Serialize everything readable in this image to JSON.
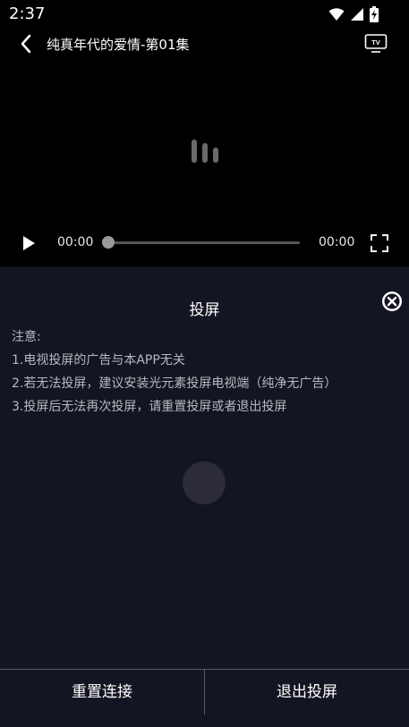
{
  "status_bar": {
    "time": "2:37",
    "icons": [
      "wifi-icon",
      "signal-icon",
      "battery-charging-icon"
    ]
  },
  "header": {
    "title": "纯真年代的爱情-第01集",
    "back_icon": "chevron-left-icon",
    "tv_icon": "tv-cast-icon",
    "tv_label": "TV"
  },
  "player": {
    "current_time": "00:00",
    "total_time": "00:00",
    "progress": 0,
    "play_icon": "play-icon",
    "fullscreen_icon": "fullscreen-icon",
    "loading_icon": "loading-bars-icon"
  },
  "cast_panel": {
    "title": "投屏",
    "close_icon": "close-icon",
    "notes": [
      "注意:",
      "1.电视投屏的广告与本APP无关",
      "2.若无法投屏，建议安装光元素投屏电视端（纯净无广告）",
      "3.投屏后无法再次投屏，请重置投屏或者退出投屏"
    ]
  },
  "bottom_bar": {
    "reset_label": "重置连接",
    "exit_label": "退出投屏"
  },
  "colors": {
    "panel_bg": "#141522",
    "video_bg": "#000000",
    "divider": "#5a5b66",
    "seek_track": "#555555"
  }
}
